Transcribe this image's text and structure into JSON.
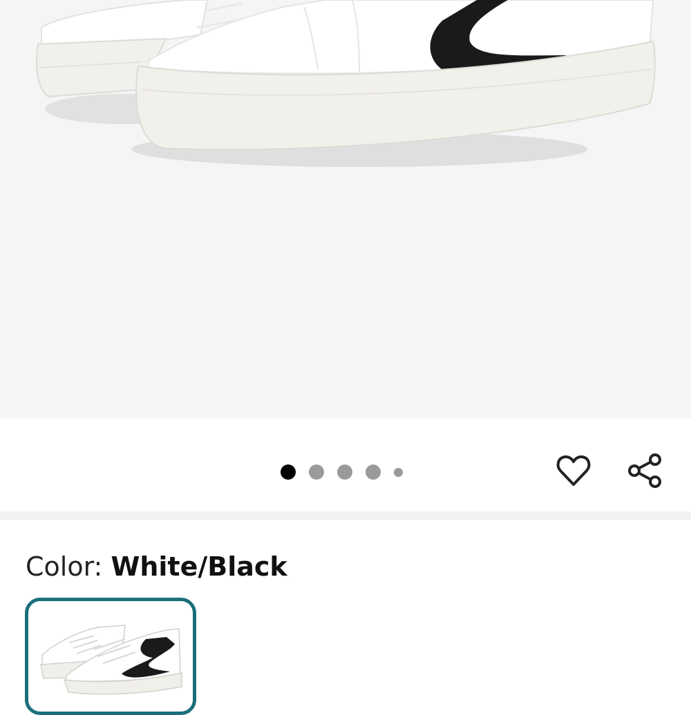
{
  "product_gallery": {
    "image_alt": "White/Black sneaker",
    "pagination": {
      "total": 5,
      "active_index": 0
    }
  },
  "actions": {
    "favorite_icon": "heart-outline-icon",
    "share_icon": "share-icon"
  },
  "color_selector": {
    "label": "Color:",
    "selected_value": "White/Black",
    "swatches": [
      {
        "name": "White/Black",
        "selected": true
      }
    ],
    "selected_border_color": "#1a6f7a"
  }
}
